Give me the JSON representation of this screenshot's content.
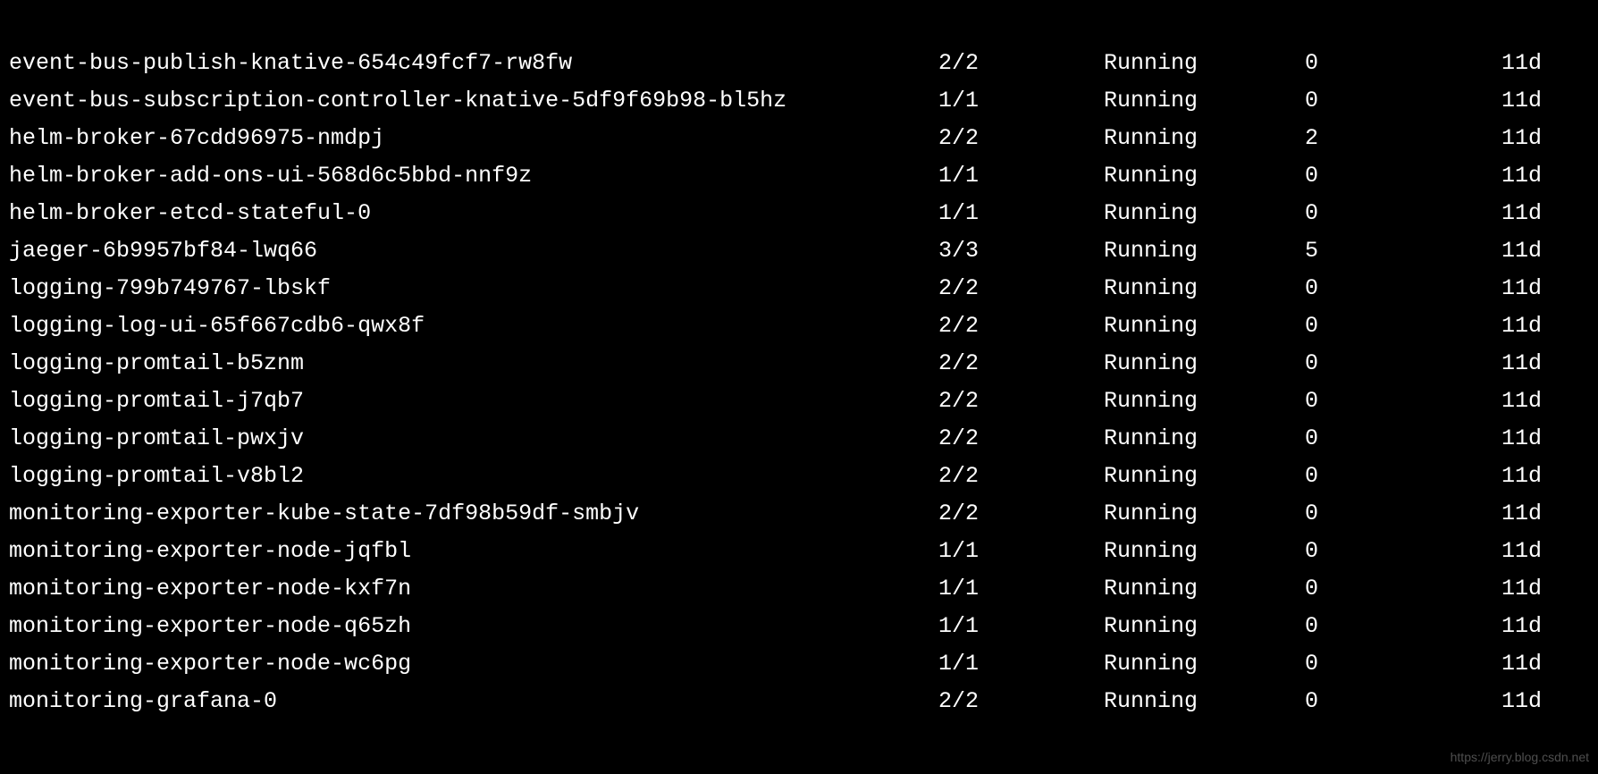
{
  "pods": [
    {
      "name": "event-bus-publish-knative-654c49fcf7-rw8fw",
      "ready": "2/2",
      "status": "Running",
      "restarts": "0",
      "age": "11d"
    },
    {
      "name": "event-bus-subscription-controller-knative-5df9f69b98-bl5hz",
      "ready": "1/1",
      "status": "Running",
      "restarts": "0",
      "age": "11d"
    },
    {
      "name": "helm-broker-67cdd96975-nmdpj",
      "ready": "2/2",
      "status": "Running",
      "restarts": "2",
      "age": "11d"
    },
    {
      "name": "helm-broker-add-ons-ui-568d6c5bbd-nnf9z",
      "ready": "1/1",
      "status": "Running",
      "restarts": "0",
      "age": "11d"
    },
    {
      "name": "helm-broker-etcd-stateful-0",
      "ready": "1/1",
      "status": "Running",
      "restarts": "0",
      "age": "11d"
    },
    {
      "name": "jaeger-6b9957bf84-lwq66",
      "ready": "3/3",
      "status": "Running",
      "restarts": "5",
      "age": "11d"
    },
    {
      "name": "logging-799b749767-lbskf",
      "ready": "2/2",
      "status": "Running",
      "restarts": "0",
      "age": "11d"
    },
    {
      "name": "logging-log-ui-65f667cdb6-qwx8f",
      "ready": "2/2",
      "status": "Running",
      "restarts": "0",
      "age": "11d"
    },
    {
      "name": "logging-promtail-b5znm",
      "ready": "2/2",
      "status": "Running",
      "restarts": "0",
      "age": "11d"
    },
    {
      "name": "logging-promtail-j7qb7",
      "ready": "2/2",
      "status": "Running",
      "restarts": "0",
      "age": "11d"
    },
    {
      "name": "logging-promtail-pwxjv",
      "ready": "2/2",
      "status": "Running",
      "restarts": "0",
      "age": "11d"
    },
    {
      "name": "logging-promtail-v8bl2",
      "ready": "2/2",
      "status": "Running",
      "restarts": "0",
      "age": "11d"
    },
    {
      "name": "monitoring-exporter-kube-state-7df98b59df-smbjv",
      "ready": "2/2",
      "status": "Running",
      "restarts": "0",
      "age": "11d"
    },
    {
      "name": "monitoring-exporter-node-jqfbl",
      "ready": "1/1",
      "status": "Running",
      "restarts": "0",
      "age": "11d"
    },
    {
      "name": "monitoring-exporter-node-kxf7n",
      "ready": "1/1",
      "status": "Running",
      "restarts": "0",
      "age": "11d"
    },
    {
      "name": "monitoring-exporter-node-q65zh",
      "ready": "1/1",
      "status": "Running",
      "restarts": "0",
      "age": "11d"
    },
    {
      "name": "monitoring-exporter-node-wc6pg",
      "ready": "1/1",
      "status": "Running",
      "restarts": "0",
      "age": "11d"
    },
    {
      "name": "monitoring-grafana-0",
      "ready": "2/2",
      "status": "Running",
      "restarts": "0",
      "age": "11d"
    }
  ],
  "watermark": "https://jerry.blog.csdn.net"
}
